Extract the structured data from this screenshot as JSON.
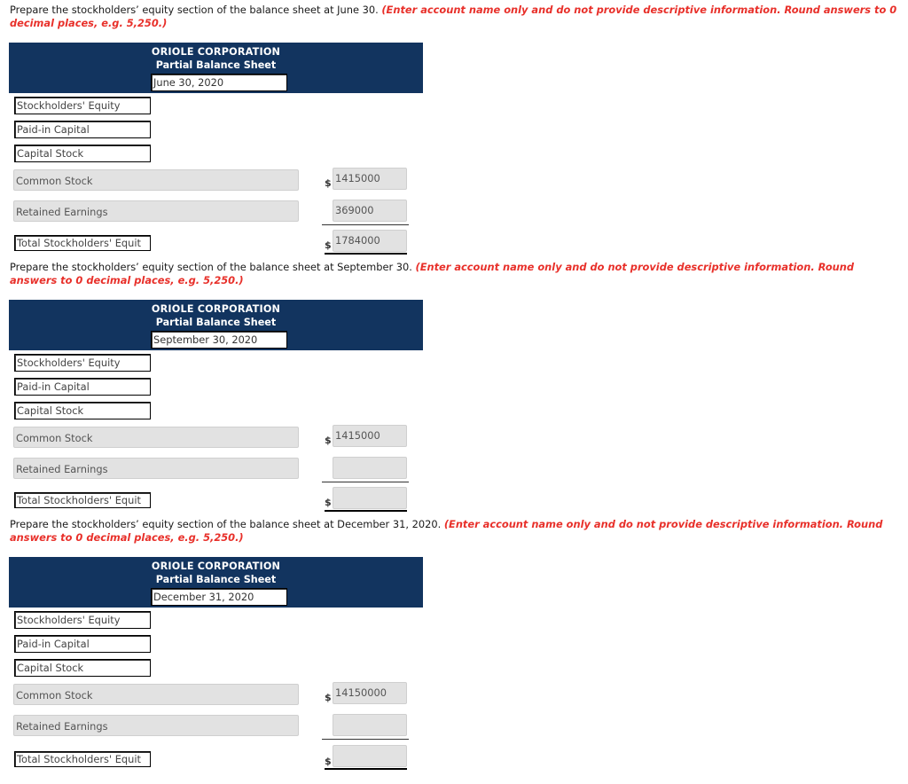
{
  "sections": [
    {
      "instruction_plain": "Prepare the stockholders’ equity section of the balance sheet at June 30. ",
      "instruction_note": "(Enter account name only and do not provide descriptive information. Round answers to 0 decimal places, e.g. 5,250.)",
      "header": {
        "company": "ORIOLE CORPORATION",
        "statement": "Partial Balance Sheet",
        "date": "June 30, 2020"
      },
      "labels": {
        "heading1": "Stockholders' Equity",
        "heading2": "Paid-in Capital",
        "heading3": "Capital Stock"
      },
      "rows": {
        "common_stock": {
          "account": "Common Stock",
          "currency": "$",
          "amount": "1415000"
        },
        "retained_earnings": {
          "account": "Retained Earnings",
          "amount": "369000"
        },
        "total": {
          "account": "Total Stockholders' Equit",
          "currency": "$",
          "amount": "1784000"
        }
      }
    },
    {
      "instruction_plain": "Prepare the stockholders’ equity section of the balance sheet at September 30. ",
      "instruction_note": "(Enter account name only and do not provide descriptive information. Round answers to 0 decimal places, e.g. 5,250.)",
      "header": {
        "company": "ORIOLE CORPORATION",
        "statement": "Partial Balance Sheet",
        "date": "September 30, 2020"
      },
      "labels": {
        "heading1": "Stockholders' Equity",
        "heading2": "Paid-in Capital",
        "heading3": "Capital Stock"
      },
      "rows": {
        "common_stock": {
          "account": "Common Stock",
          "currency": "$",
          "amount": "1415000"
        },
        "retained_earnings": {
          "account": "Retained Earnings",
          "amount": ""
        },
        "total": {
          "account": "Total Stockholders' Equit",
          "currency": "$",
          "amount": ""
        }
      }
    },
    {
      "instruction_plain": "Prepare the stockholders’ equity section of the balance sheet at December 31, 2020. ",
      "instruction_note": "(Enter account name only and do not provide descriptive information. Round answers to 0 decimal places, e.g. 5,250.)",
      "header": {
        "company": "ORIOLE CORPORATION",
        "statement": "Partial Balance Sheet",
        "date": "December 31, 2020"
      },
      "labels": {
        "heading1": "Stockholders' Equity",
        "heading2": "Paid-in Capital",
        "heading3": "Capital Stock"
      },
      "rows": {
        "common_stock": {
          "account": "Common Stock",
          "currency": "$",
          "amount": "14150000"
        },
        "retained_earnings": {
          "account": "Retained Earnings",
          "amount": ""
        },
        "total": {
          "account": "Total Stockholders' Equit",
          "currency": "$",
          "amount": ""
        }
      }
    }
  ],
  "colors": {
    "header_band": "#12345f",
    "note_red": "#e8302a",
    "field_gray": "#e2e2e2"
  }
}
